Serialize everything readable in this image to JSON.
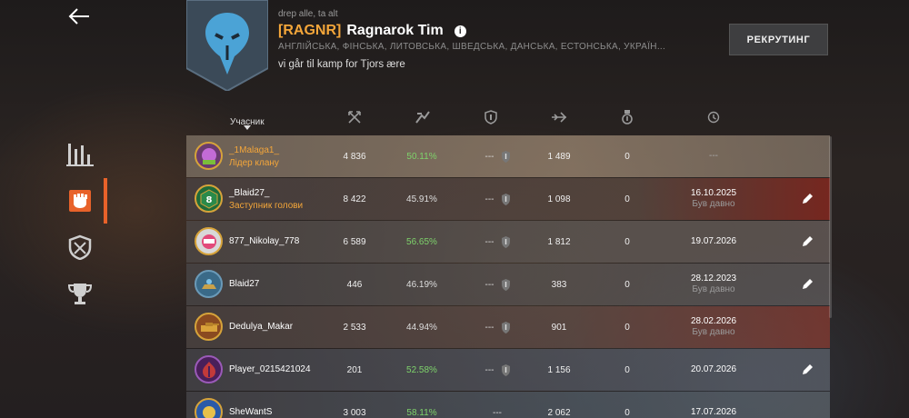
{
  "clan": {
    "motto": "drep alle, ta alt",
    "tag": "[RAGNR]",
    "name": "Ragnarok Tim",
    "languages": "АНГЛІЙСЬКА, ФІНСЬКА, ЛИТОВСЬКА, ШВЕДСЬКА, ДАНСЬКА, ЕСТОНСЬКА, УКРАЇН...",
    "description": "vi går til kamp for Tjors ære",
    "recruit_label": "РЕКРУТИНГ"
  },
  "table": {
    "member_header": "Учасник",
    "columns": [
      "battles-icon",
      "winrate-icon",
      "rating-icon",
      "damage-icon",
      "medal-icon",
      "clock-icon"
    ],
    "rows": [
      {
        "name": "_1Malaga1_",
        "role": "Лідер клану",
        "battles": "4 836",
        "winrate": "50.11%",
        "rating": "---",
        "damage": "1 489",
        "medals": "0",
        "date": "---",
        "date_sub": "",
        "editable": false
      },
      {
        "name": "_Blaid27_",
        "role": "Заступник голови",
        "battles": "8 422",
        "winrate": "45.91%",
        "rating": "---",
        "damage": "1 098",
        "medals": "0",
        "date": "16.10.2025",
        "date_sub": "Був давно",
        "editable": true
      },
      {
        "name": "877_Nikolay_778",
        "role": "",
        "battles": "6 589",
        "winrate": "56.65%",
        "rating": "---",
        "damage": "1 812",
        "medals": "0",
        "date": "19.07.2026",
        "date_sub": "",
        "editable": true
      },
      {
        "name": "Blaid27",
        "role": "",
        "battles": "446",
        "winrate": "46.19%",
        "rating": "---",
        "damage": "383",
        "medals": "0",
        "date": "28.12.2023",
        "date_sub": "Був давно",
        "editable": true
      },
      {
        "name": "Dedulya_Makar",
        "role": "",
        "battles": "2 533",
        "winrate": "44.94%",
        "rating": "---",
        "damage": "901",
        "medals": "0",
        "date": "28.02.2026",
        "date_sub": "Був давно",
        "editable": true
      },
      {
        "name": "Player_0215421024",
        "role": "",
        "battles": "201",
        "winrate": "52.58%",
        "rating": "---",
        "damage": "1 156",
        "medals": "0",
        "date": "20.07.2026",
        "date_sub": "",
        "editable": true
      },
      {
        "name": "SheWantS",
        "role": "",
        "battles": "3 003",
        "winrate": "58.11%",
        "rating": "---",
        "damage": "2 062",
        "medals": "0",
        "date": "17.07.2026",
        "date_sub": "",
        "editable": true
      }
    ]
  },
  "colors": {
    "accent": "#e8622a",
    "gold": "#f4a63a",
    "winrate": "#7ed36b"
  }
}
